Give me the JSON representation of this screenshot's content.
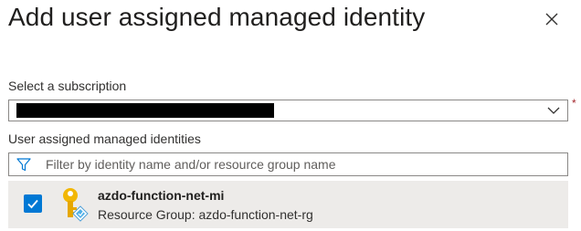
{
  "dialog": {
    "title": "Add user assigned managed identity"
  },
  "subscription": {
    "label": "Select a subscription",
    "required_marker": "*",
    "selected_value": "████████████████████"
  },
  "identities": {
    "label": "User assigned managed identities",
    "filter_placeholder": "Filter by identity name and/or resource group name",
    "filter_value": "",
    "items": [
      {
        "name": "azdo-function-net-mi",
        "resource_group": "Resource Group: azdo-function-net-rg",
        "checked": true,
        "icon": "managed-identity-key-icon"
      }
    ]
  },
  "colors": {
    "accent": "#0078d4",
    "required": "#a4262c",
    "row_selected_bg": "#edebe9",
    "border": "#8a8886"
  }
}
